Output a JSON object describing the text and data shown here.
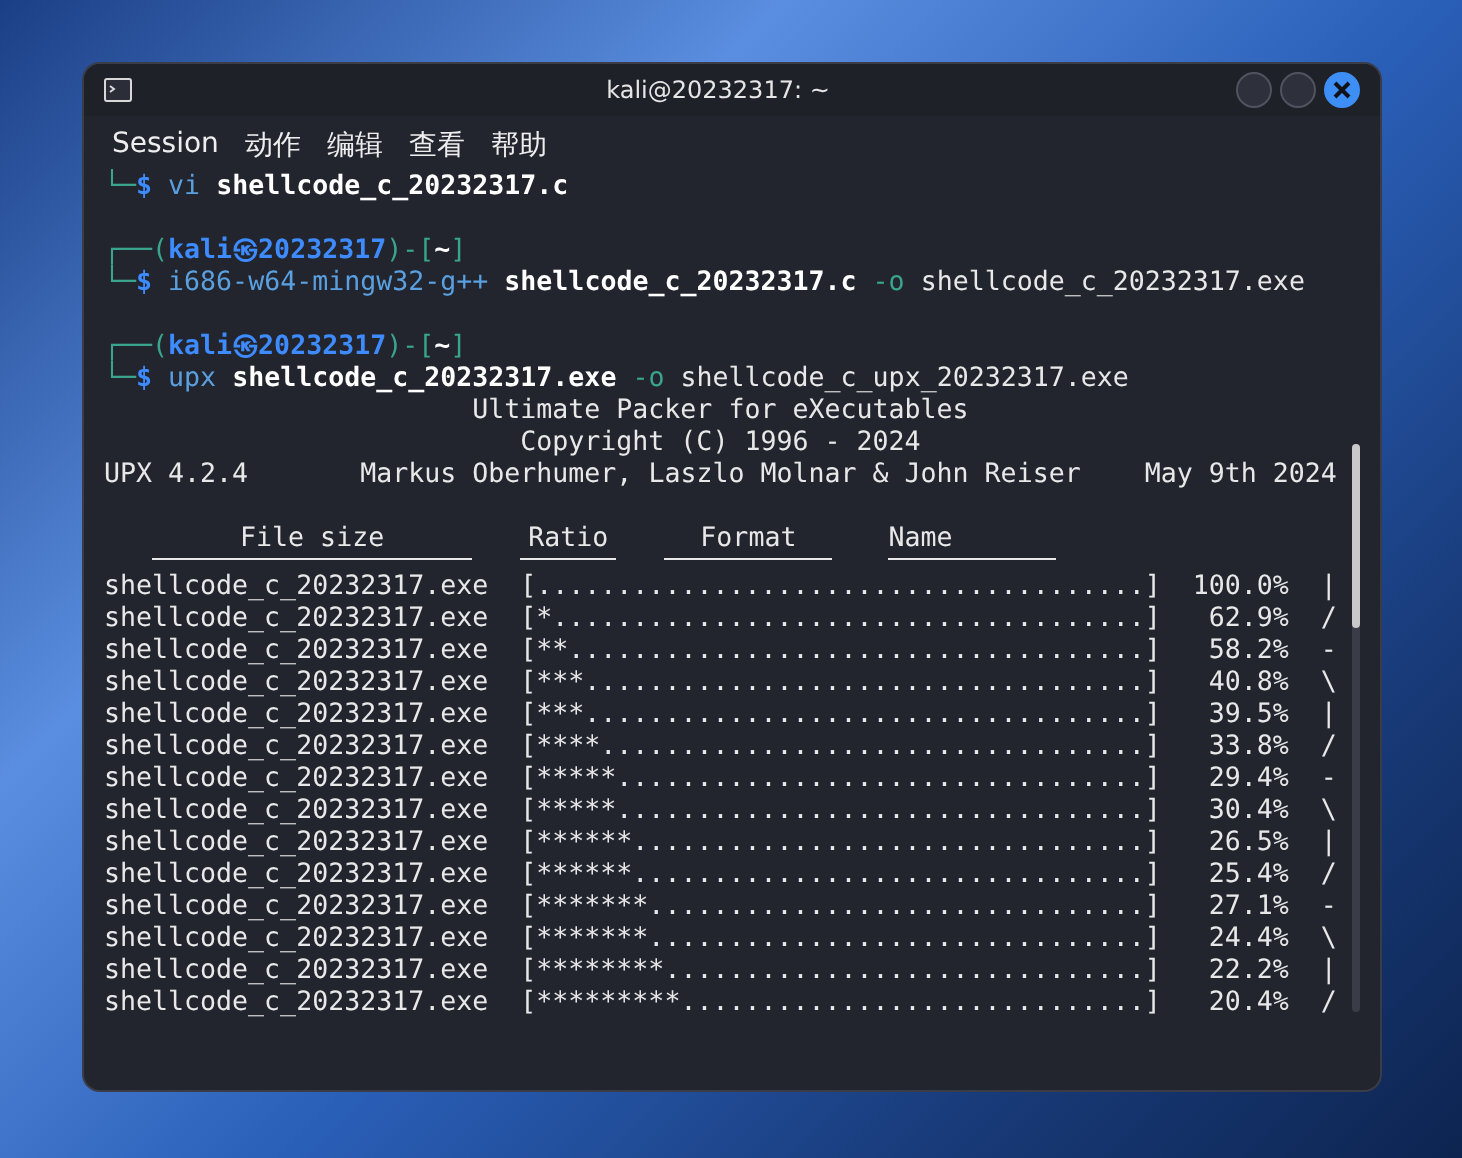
{
  "window": {
    "title": "kali@20232317: ~"
  },
  "menu": [
    "Session",
    "动作",
    "编辑",
    "查看",
    "帮助"
  ],
  "terminal": {
    "lines": [
      {
        "kind": "command",
        "segments": [
          {
            "text": "└─",
            "kind": "frame"
          },
          {
            "text": "$",
            "kind": "sigil"
          },
          {
            "text": " vi",
            "kind": "prog"
          },
          {
            "text": " shellcode_c_20232317.c",
            "kind": "file"
          }
        ]
      },
      {
        "kind": "blank"
      },
      {
        "kind": "prompt",
        "segments": [
          {
            "text": "┌──(",
            "kind": "frame"
          },
          {
            "text": "kali㉿20232317",
            "kind": "user"
          },
          {
            "text": ")-[",
            "kind": "frame"
          },
          {
            "text": "~",
            "kind": "file"
          },
          {
            "text": "]",
            "kind": "frame"
          }
        ]
      },
      {
        "kind": "command",
        "segments": [
          {
            "text": "└─",
            "kind": "frame"
          },
          {
            "text": "$",
            "kind": "sigil"
          },
          {
            "text": " i686-w64-mingw32-g++",
            "kind": "prog"
          },
          {
            "text": " shellcode_c_20232317.c",
            "kind": "file"
          },
          {
            "text": " -o",
            "kind": "flag"
          },
          {
            "text": " shellcode_c_20232317.exe",
            "kind": "plain"
          }
        ]
      },
      {
        "kind": "blank"
      },
      {
        "kind": "prompt",
        "segments": [
          {
            "text": "┌──(",
            "kind": "frame"
          },
          {
            "text": "kali㉿20232317",
            "kind": "user"
          },
          {
            "text": ")-[",
            "kind": "frame"
          },
          {
            "text": "~",
            "kind": "file"
          },
          {
            "text": "]",
            "kind": "frame"
          }
        ]
      },
      {
        "kind": "command",
        "segments": [
          {
            "text": "└─",
            "kind": "frame"
          },
          {
            "text": "$",
            "kind": "sigil"
          },
          {
            "text": " upx",
            "kind": "prog"
          },
          {
            "text": " shellcode_c_20232317.exe",
            "kind": "file"
          },
          {
            "text": " -o",
            "kind": "flag"
          },
          {
            "text": " shellcode_c_upx_20232317.exe",
            "kind": "plain"
          }
        ]
      },
      {
        "kind": "center",
        "text": "Ultimate Packer for eXecutables"
      },
      {
        "kind": "center",
        "text": "Copyright (C) 1996 - 2024"
      },
      {
        "kind": "banner",
        "parts": [
          "UPX 4.2.4",
          "Markus Oberhumer, Laszlo Molnar & John Reiser",
          "May 9th 2024"
        ]
      },
      {
        "kind": "blank"
      }
    ],
    "columns": [
      "File size",
      "Ratio",
      "Format",
      "Name"
    ],
    "rows": [
      {
        "file": "shellcode_c_20232317.exe",
        "bar": "[......................................]",
        "ratio": "100.0%",
        "spinner": "|"
      },
      {
        "file": "shellcode_c_20232317.exe",
        "bar": "[*.....................................]",
        "ratio": "62.9%",
        "spinner": "/"
      },
      {
        "file": "shellcode_c_20232317.exe",
        "bar": "[**....................................]",
        "ratio": "58.2%",
        "spinner": "-"
      },
      {
        "file": "shellcode_c_20232317.exe",
        "bar": "[***...................................]",
        "ratio": "40.8%",
        "spinner": "\\"
      },
      {
        "file": "shellcode_c_20232317.exe",
        "bar": "[***...................................]",
        "ratio": "39.5%",
        "spinner": "|"
      },
      {
        "file": "shellcode_c_20232317.exe",
        "bar": "[****..................................]",
        "ratio": "33.8%",
        "spinner": "/"
      },
      {
        "file": "shellcode_c_20232317.exe",
        "bar": "[*****.................................]",
        "ratio": "29.4%",
        "spinner": "-"
      },
      {
        "file": "shellcode_c_20232317.exe",
        "bar": "[*****.................................]",
        "ratio": "30.4%",
        "spinner": "\\"
      },
      {
        "file": "shellcode_c_20232317.exe",
        "bar": "[******................................]",
        "ratio": "26.5%",
        "spinner": "|"
      },
      {
        "file": "shellcode_c_20232317.exe",
        "bar": "[******................................]",
        "ratio": "25.4%",
        "spinner": "/"
      },
      {
        "file": "shellcode_c_20232317.exe",
        "bar": "[*******...............................]",
        "ratio": "27.1%",
        "spinner": "-"
      },
      {
        "file": "shellcode_c_20232317.exe",
        "bar": "[*******...............................]",
        "ratio": "24.4%",
        "spinner": "\\"
      },
      {
        "file": "shellcode_c_20232317.exe",
        "bar": "[********..............................]",
        "ratio": "22.2%",
        "spinner": "|"
      },
      {
        "file": "shellcode_c_20232317.exe",
        "bar": "[*********.............................]",
        "ratio": "20.4%",
        "spinner": "/"
      }
    ]
  }
}
